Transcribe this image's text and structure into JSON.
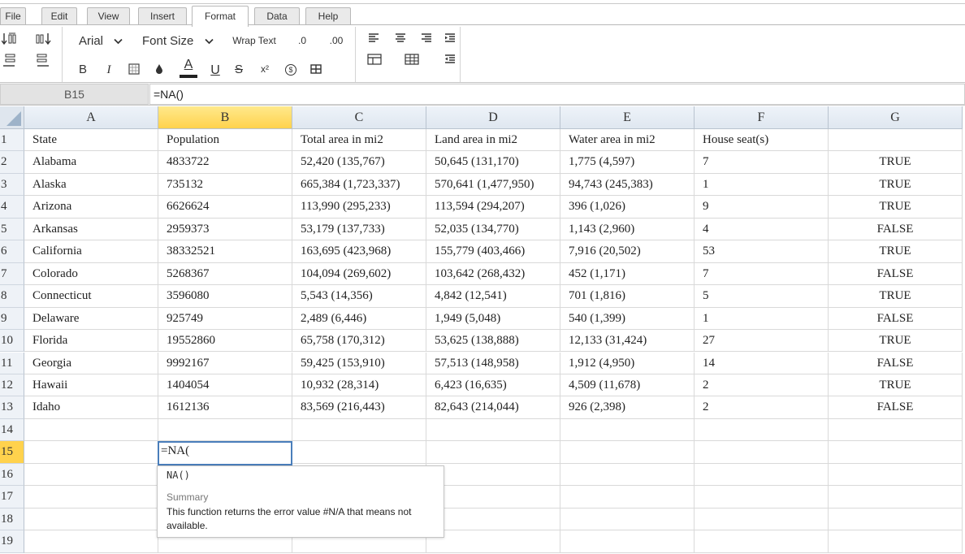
{
  "menu": {
    "tabs": [
      {
        "label": "File"
      },
      {
        "label": "Edit"
      },
      {
        "label": "View"
      },
      {
        "label": "Insert"
      },
      {
        "label": "Format"
      },
      {
        "label": "Data"
      },
      {
        "label": "Help"
      }
    ],
    "active_tab": "Format"
  },
  "toolbar": {
    "font_family": "Arial",
    "font_size_label": "Font Size",
    "wrap_text_label": "Wrap Text",
    "decimal_decrease_label": ".0",
    "decimal_increase_label": ".00",
    "bold_label": "B",
    "italic_label": "I",
    "font_color_label": "A",
    "underline_label": "U",
    "strike_label": "S",
    "superscript_label": "x²",
    "currency_label": "$"
  },
  "formula_bar": {
    "cell_ref": "B15",
    "formula": "=NA()"
  },
  "sheet": {
    "selected_column": "B",
    "selected_row": "15",
    "columns": [
      "A",
      "B",
      "C",
      "D",
      "E",
      "F",
      "G"
    ],
    "rows": [
      {
        "num": "1",
        "cells": [
          "State",
          "Population",
          "Total area in mi2",
          "Land area in mi2",
          "Water area in mi2",
          "House seat(s)",
          ""
        ]
      },
      {
        "num": "2",
        "cells": [
          "Alabama",
          "4833722",
          "52,420 (135,767)",
          "50,645 (131,170)",
          "1,775 (4,597)",
          "7",
          "TRUE"
        ]
      },
      {
        "num": "3",
        "cells": [
          "Alaska",
          "735132",
          "665,384 (1,723,337)",
          "570,641 (1,477,950)",
          "94,743 (245,383)",
          "1",
          "TRUE"
        ]
      },
      {
        "num": "4",
        "cells": [
          "Arizona",
          "6626624",
          "113,990 (295,233)",
          "113,594 (294,207)",
          "396 (1,026)",
          "9",
          "TRUE"
        ]
      },
      {
        "num": "5",
        "cells": [
          "Arkansas",
          "2959373",
          "53,179 (137,733)",
          "52,035 (134,770)",
          "1,143 (2,960)",
          "4",
          "FALSE"
        ]
      },
      {
        "num": "6",
        "cells": [
          "California",
          "38332521",
          "163,695 (423,968)",
          "155,779 (403,466)",
          "7,916 (20,502)",
          "53",
          "TRUE"
        ]
      },
      {
        "num": "7",
        "cells": [
          "Colorado",
          "5268367",
          "104,094 (269,602)",
          "103,642 (268,432)",
          "452 (1,171)",
          "7",
          "FALSE"
        ]
      },
      {
        "num": "8",
        "cells": [
          "Connecticut",
          "3596080",
          "5,543 (14,356)",
          "4,842 (12,541)",
          "701 (1,816)",
          "5",
          "TRUE"
        ]
      },
      {
        "num": "9",
        "cells": [
          "Delaware",
          "925749",
          "2,489 (6,446)",
          "1,949 (5,048)",
          "540 (1,399)",
          "1",
          "FALSE"
        ]
      },
      {
        "num": "10",
        "cells": [
          "Florida",
          "19552860",
          "65,758 (170,312)",
          "53,625 (138,888)",
          "12,133 (31,424)",
          "27",
          "TRUE"
        ]
      },
      {
        "num": "11",
        "cells": [
          "Georgia",
          "9992167",
          "59,425 (153,910)",
          "57,513 (148,958)",
          "1,912 (4,950)",
          "14",
          "FALSE"
        ]
      },
      {
        "num": "12",
        "cells": [
          "Hawaii",
          "1404054",
          "10,932 (28,314)",
          "6,423 (16,635)",
          "4,509 (11,678)",
          "2",
          "TRUE"
        ]
      },
      {
        "num": "13",
        "cells": [
          "Idaho",
          "1612136",
          "83,569 (216,443)",
          "82,643 (214,044)",
          "926 (2,398)",
          "2",
          "FALSE"
        ]
      },
      {
        "num": "14",
        "cells": [
          "",
          "",
          "",
          "",
          "",
          "",
          ""
        ]
      },
      {
        "num": "15",
        "cells": [
          "",
          "",
          "",
          "",
          "",
          "",
          ""
        ]
      },
      {
        "num": "16",
        "cells": [
          "",
          "",
          "",
          "",
          "",
          "",
          ""
        ]
      },
      {
        "num": "17",
        "cells": [
          "",
          "",
          "",
          "",
          "",
          "",
          ""
        ]
      },
      {
        "num": "18",
        "cells": [
          "",
          "",
          "",
          "",
          "",
          "",
          ""
        ]
      },
      {
        "num": "19",
        "cells": [
          "",
          "",
          "",
          "",
          "",
          "",
          ""
        ]
      }
    ],
    "editor_value": "=NA("
  },
  "autocomplete": {
    "function_signature": "NA()",
    "summary_label": "Summary",
    "description": "This function returns the error value #N/A that means not available."
  },
  "colors": {
    "selection_header": "#ffd24d",
    "editor_border": "#4a7ebb"
  }
}
